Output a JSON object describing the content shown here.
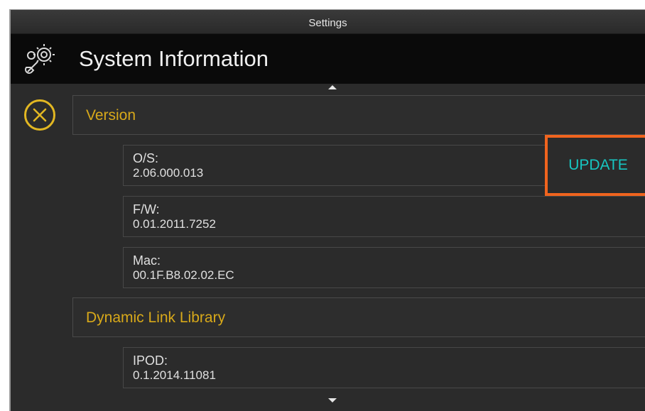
{
  "window": {
    "title": "Settings"
  },
  "header": {
    "title": "System Information",
    "icon": "settings-gear-wrench-icon"
  },
  "sections": {
    "version": {
      "label": "Version",
      "items": [
        {
          "key": "O/S:",
          "value": "2.06.000.013"
        },
        {
          "key": "F/W:",
          "value": "0.01.2011.7252"
        },
        {
          "key": "Mac:",
          "value": "00.1F.B8.02.02.EC"
        }
      ]
    },
    "dll": {
      "label": "Dynamic Link Library",
      "items": [
        {
          "key": "IPOD:",
          "value": "0.1.2014.11081"
        }
      ]
    }
  },
  "update_button": {
    "label": "UPDATE"
  },
  "colors": {
    "accent": "#d8a91a",
    "update_text": "#17c6c1",
    "highlight_border": "#f0641e",
    "background": "#2b2b2b"
  }
}
